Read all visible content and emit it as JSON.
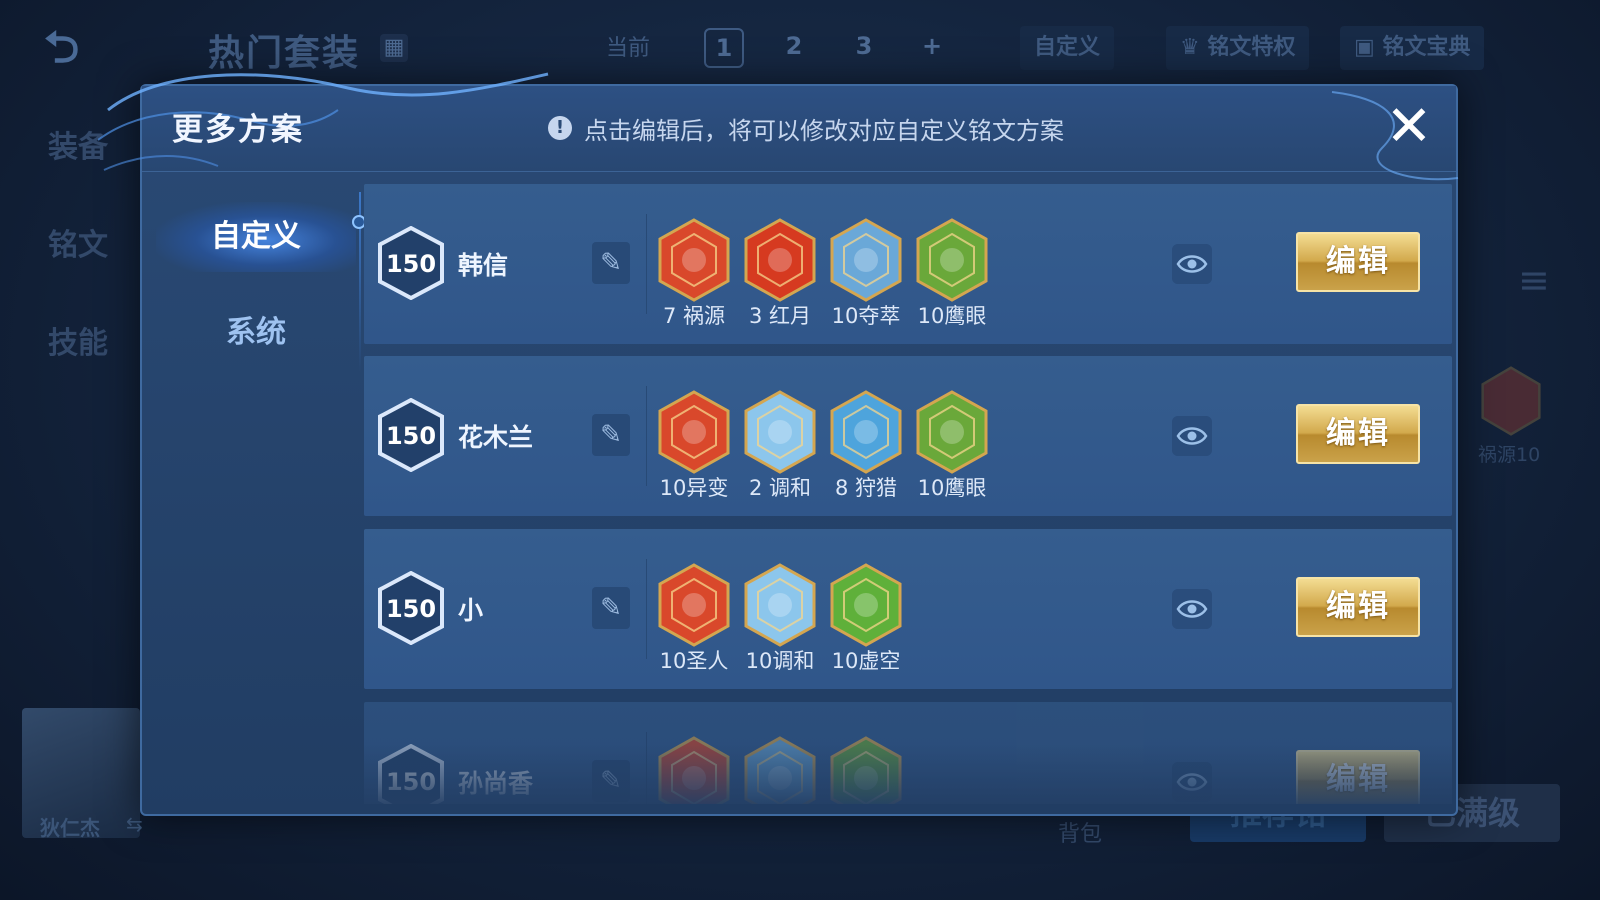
{
  "background": {
    "back_glyph": "⮌",
    "title": "热门套装",
    "grid_glyph": "▦",
    "current_label": "当前",
    "pages": [
      "1",
      "2",
      "3",
      "+"
    ],
    "custom_label": "自定义",
    "privilege_label": "铭文特权",
    "codex_label": "铭文宝典",
    "side_tabs": [
      "装备",
      "铭文",
      "技能"
    ],
    "menu_glyph": "≡",
    "side_rune_label": "祸源10",
    "hero_name": "狄仁杰",
    "swap_glyph": "⇆",
    "bag_label": "背包",
    "btn_recommend": "推荐铭",
    "btn_maxlevel": "已满级"
  },
  "modal": {
    "title": "更多方案",
    "hint_icon": "!",
    "hint": "点击编辑后，将可以修改对应自定义铭文方案",
    "close_glyph": "✕",
    "tabs": [
      {
        "label": "自定义",
        "active": true
      },
      {
        "label": "系统",
        "active": false
      }
    ],
    "rename_glyph": "✎",
    "edit_label": "编辑",
    "schemes": [
      {
        "level": "150",
        "hero": "韩信",
        "runes": [
          {
            "label": "7 祸源",
            "icon": "red-rune-icon",
            "color": "#d9482b"
          },
          {
            "label": "3 红月",
            "icon": "red-moon-rune-icon",
            "color": "#d63a20"
          },
          {
            "label": "10夺萃",
            "icon": "blue-rune-icon",
            "color": "#6aa8d8"
          },
          {
            "label": "10鹰眼",
            "icon": "green-rune-icon",
            "color": "#6aa83a"
          }
        ]
      },
      {
        "level": "150",
        "hero": "花木兰",
        "runes": [
          {
            "label": "10异变",
            "icon": "red-rune-icon",
            "color": "#d9482b"
          },
          {
            "label": "2 调和",
            "icon": "blue-drop-rune-icon",
            "color": "#8cc6ec"
          },
          {
            "label": "8 狩猎",
            "icon": "blue-lightning-rune-icon",
            "color": "#4ea4dc"
          },
          {
            "label": "10鹰眼",
            "icon": "green-rune-icon",
            "color": "#6aa83a"
          }
        ]
      },
      {
        "level": "150",
        "hero": "小",
        "runes": [
          {
            "label": "10圣人",
            "icon": "red-rune-icon",
            "color": "#d9482b"
          },
          {
            "label": "10调和",
            "icon": "blue-drop-rune-icon",
            "color": "#8cc6ec"
          },
          {
            "label": "10虚空",
            "icon": "green-rune-icon",
            "color": "#5fb03a"
          }
        ]
      },
      {
        "level": "150",
        "hero": "孙尚香",
        "runes": [
          {
            "label": "",
            "icon": "red-rune-icon",
            "color": "#d9482b"
          },
          {
            "label": "",
            "icon": "blue-rune-icon",
            "color": "#6aa8d8"
          },
          {
            "label": "",
            "icon": "green-rune-icon",
            "color": "#6aa83a"
          }
        ]
      }
    ]
  }
}
